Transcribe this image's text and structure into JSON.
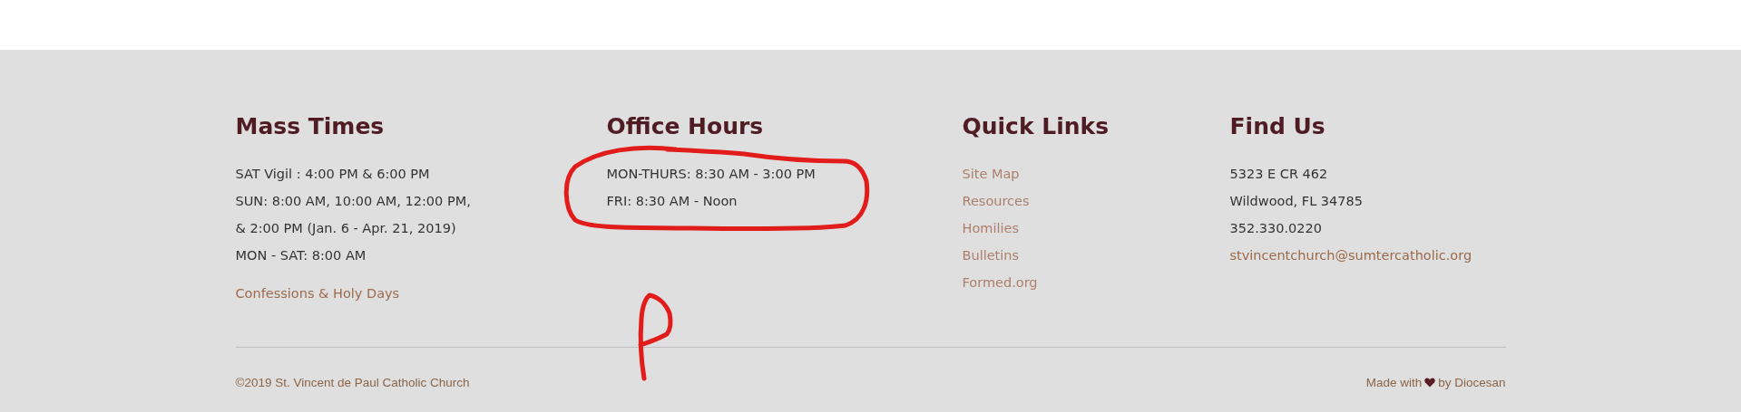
{
  "footer": {
    "columns": [
      {
        "heading": "Mass Times",
        "lines": [
          "SAT Vigil : 4:00 PM & 6:00 PM",
          "SUN: 8:00 AM, 10:00 AM, 12:00 PM,",
          "& 2:00 PM (Jan. 6 - Apr. 21, 2019)",
          "MON - SAT: 8:00 AM"
        ],
        "links": [
          "Confessions & Holy Days"
        ]
      },
      {
        "heading": "Office Hours",
        "lines": [
          "MON-THURS: 8:30 AM - 3:00 PM",
          "FRI: 8:30 AM - Noon"
        ]
      },
      {
        "heading": "Quick Links",
        "nav": [
          "Site Map",
          "Resources",
          "Homilies",
          "Bulletins",
          "Formed.org"
        ]
      },
      {
        "heading": "Find Us",
        "lines": [
          "5323 E CR 462",
          "Wildwood, FL 34785",
          "352.330.0220"
        ],
        "email": "stvincentchurch@sumtercatholic.org"
      }
    ],
    "copyright": "©2019 St. Vincent de Paul Catholic Church",
    "credit": {
      "before": "Made with",
      "after": "by Diocesan"
    }
  },
  "ink_marks": {
    "circle": true,
    "scribble": true
  }
}
